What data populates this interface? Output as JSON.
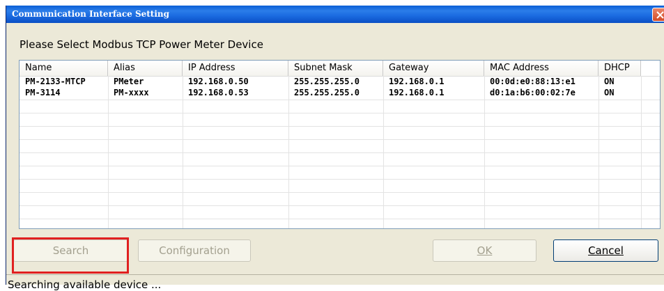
{
  "window": {
    "title": "Communication Interface Setting"
  },
  "heading": "Please Select Modbus TCP Power Meter Device",
  "table": {
    "columns": [
      "Name",
      "Alias",
      "IP Address",
      "Subnet Mask",
      "Gateway",
      "MAC Address",
      "DHCP"
    ],
    "rows": [
      [
        "PM-2133-MTCP",
        "PMeter",
        "192.168.0.50",
        "255.255.255.0",
        "192.168.0.1",
        "00:0d:e0:88:13:e1",
        "ON"
      ],
      [
        "PM-3114",
        "PM-xxxx",
        "192.168.0.53",
        "255.255.255.0",
        "192.168.0.1",
        "d0:1a:b6:00:02:7e",
        "ON"
      ]
    ]
  },
  "buttons": {
    "search": "Search",
    "configuration": "Configuration",
    "ok": "OK",
    "cancel": "Cancel"
  },
  "status": "Searching available device ...",
  "colors": {
    "title_bar": "#0b5cd8",
    "highlight": "#e02020",
    "close": "#d34b27"
  }
}
